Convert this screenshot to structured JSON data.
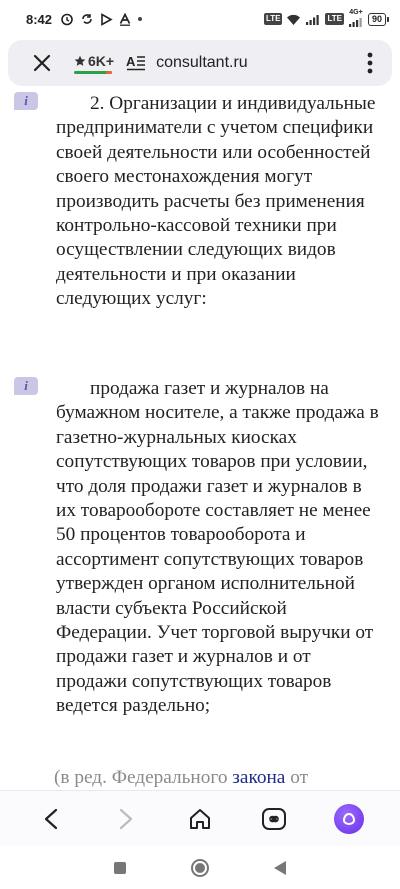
{
  "status_bar": {
    "time": "8:42",
    "sim1": "LTE",
    "network_label": "4G+",
    "battery": "90"
  },
  "browser": {
    "rating": "6K+",
    "url": "consultant.ru"
  },
  "document": {
    "paragraph_1": "2. Организации и индивидуальные предприниматели с учетом специфики своей деятельности или особенностей своего местонахождения могут производить расчеты без применения контрольно-кассовой техники при осуществлении следующих видов деятельности и при оказании следующих услуг:",
    "paragraph_2": "продажа газет и журналов на бумажном носителе, а также продажа в газетно-журнальных киосках сопутствующих товаров при условии, что доля продажи газет и журналов в их товарообороте составляет не менее 50 процентов товарооборота и ассортимент сопутствующих товаров утвержден органом исполнительной власти субъекта Российской Федерации. Учет торговой выручки от продажи газет и журналов и от продажи сопутствующих товаров ведется раздельно;",
    "edit_note_prefix": "(в ред. Федерального ",
    "edit_note_link": "закона",
    "edit_note_suffix": " от",
    "info_badge": "i"
  },
  "colors": {
    "accent": "#6a2de8",
    "link": "#1d2b8a",
    "badge_bg": "#c9c6e6",
    "rating_green": "#2fa04a"
  }
}
